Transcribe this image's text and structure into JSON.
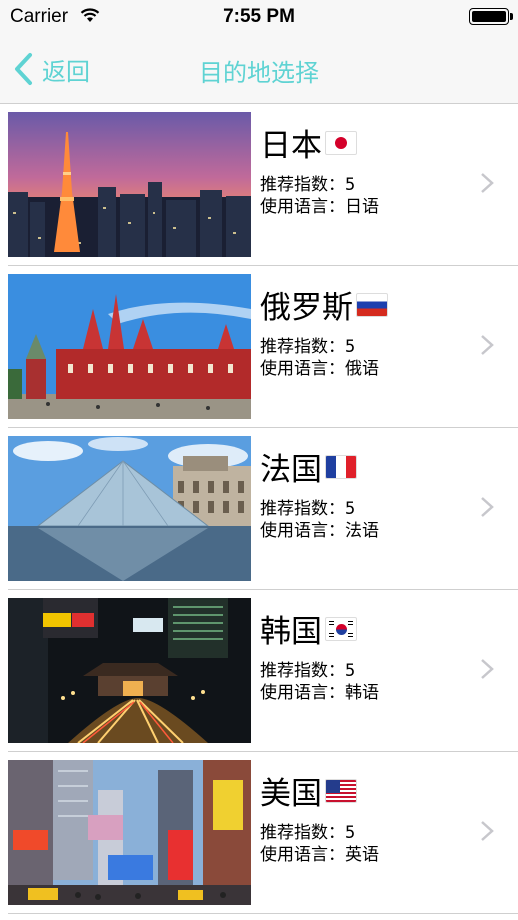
{
  "status_bar": {
    "carrier": "Carrier",
    "time": "7:55 PM",
    "battery_level": 1.0
  },
  "nav": {
    "back_label": "返回",
    "title": "目的地选择",
    "accent_color": "#5fd3d3"
  },
  "destinations": [
    {
      "name": "日本",
      "flag": "japan-flag-icon",
      "rating_label": "推荐指数：",
      "rating": "5",
      "language_label": "使用语言：",
      "language": "日语",
      "image": "tokyo-tower-night-photo"
    },
    {
      "name": "俄罗斯",
      "flag": "russia-flag-icon",
      "rating_label": "推荐指数：",
      "rating": "5",
      "language_label": "使用语言：",
      "language": "俄语",
      "image": "red-square-moscow-photo"
    },
    {
      "name": "法国",
      "flag": "france-flag-icon",
      "rating_label": "推荐指数：",
      "rating": "5",
      "language_label": "使用语言：",
      "language": "法语",
      "image": "louvre-pyramid-photo"
    },
    {
      "name": "韩国",
      "flag": "korea-flag-icon",
      "rating_label": "推荐指数：",
      "rating": "5",
      "language_label": "使用语言：",
      "language": "韩语",
      "image": "seoul-night-street-photo"
    },
    {
      "name": "美国",
      "flag": "usa-flag-icon",
      "rating_label": "推荐指数：",
      "rating": "5",
      "language_label": "使用语言：",
      "language": "英语",
      "image": "times-square-photo"
    }
  ]
}
